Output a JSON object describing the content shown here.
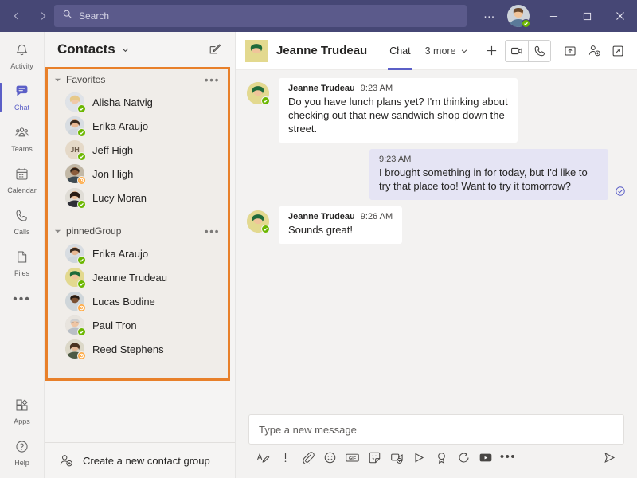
{
  "titlebar": {
    "back_icon": "chevron-left-icon",
    "forward_icon": "chevron-right-icon",
    "search_placeholder": "Search",
    "search_icon": "search-icon",
    "more_label": "…",
    "minimize_label": "—",
    "maximize_label": "□",
    "close_label": "✕",
    "accent_color": "#464775",
    "my_presence": "available"
  },
  "rail": {
    "items": [
      {
        "label": "Activity",
        "icon": "bell-icon",
        "active": false
      },
      {
        "label": "Chat",
        "icon": "chat-icon",
        "active": true
      },
      {
        "label": "Teams",
        "icon": "teams-icon",
        "active": false
      },
      {
        "label": "Calendar",
        "icon": "calendar-icon",
        "active": false
      },
      {
        "label": "Calls",
        "icon": "phone-icon",
        "active": false
      },
      {
        "label": "Files",
        "icon": "file-icon",
        "active": false
      }
    ],
    "more_label": "•••",
    "bottom_items": [
      {
        "label": "Apps",
        "icon": "apps-icon"
      },
      {
        "label": "Help",
        "icon": "help-icon"
      }
    ]
  },
  "contacts": {
    "title": "Contacts",
    "title_chevron_icon": "chevron-down-icon",
    "compose_icon": "new-chat-icon",
    "highlight_color": "#e8802a",
    "groups": [
      {
        "name": "Favorites",
        "collapse_icon": "caret-down-icon",
        "overflow_label": "•••",
        "people": [
          {
            "name": "Alisha Natvig",
            "presence": "available",
            "avatar_type": "photo",
            "hair": "#e6c98a",
            "skin": "#f0c9a8",
            "shirt": "#dfe3e8"
          },
          {
            "name": "Erika Araujo",
            "presence": "available",
            "avatar_type": "photo",
            "hair": "#3a2b20",
            "skin": "#e8b894",
            "shirt": "#d8dde2"
          },
          {
            "name": "Jeff High",
            "presence": "available",
            "avatar_type": "initials",
            "initials": "JH"
          },
          {
            "name": "Jon High",
            "presence": "away",
            "avatar_type": "photo",
            "hair": "#2d2016",
            "skin": "#8a5c3b",
            "shirt": "#3e4a52"
          },
          {
            "name": "Lucy Moran",
            "presence": "available",
            "avatar_type": "photo",
            "hair": "#2a1d14",
            "skin": "#eec3a0",
            "shirt": "#2f2f38"
          }
        ]
      },
      {
        "name": "pinnedGroup",
        "collapse_icon": "caret-down-icon",
        "overflow_label": "•••",
        "people": [
          {
            "name": "Erika Araujo",
            "presence": "available",
            "avatar_type": "photo",
            "hair": "#3a2b20",
            "skin": "#e8b894",
            "shirt": "#d8dde2"
          },
          {
            "name": "Jeanne Trudeau",
            "presence": "available",
            "avatar_type": "photo",
            "hair": "#1f6b3a",
            "skin": "#f0c49a",
            "shirt": "#e3d98f"
          },
          {
            "name": "Lucas Bodine",
            "presence": "away",
            "avatar_type": "photo",
            "hair": "#241a12",
            "skin": "#7a5032",
            "shirt": "#cfd6da"
          },
          {
            "name": "Paul Tron",
            "presence": "available",
            "avatar_type": "photo",
            "hair": "#cfcfcf",
            "skin": "#eec5a4",
            "shirt": "#e8e4de"
          },
          {
            "name": "Reed Stephens",
            "presence": "away",
            "avatar_type": "photo",
            "hair": "#4a3320",
            "skin": "#e3b896",
            "shirt": "#4d5b45"
          }
        ]
      }
    ],
    "create_group_label": "Create a new contact group",
    "create_group_icon": "add-person-icon"
  },
  "chat_header": {
    "name": "Jeanne Trudeau",
    "tabs": [
      {
        "label": "Chat",
        "active": true
      },
      {
        "label": "3 more",
        "active": false,
        "chevron_icon": "chevron-down-icon"
      }
    ],
    "add_tab_label": "+",
    "actions": [
      {
        "name": "video-call-icon"
      },
      {
        "name": "audio-call-icon"
      },
      {
        "name": "share-screen-icon"
      },
      {
        "name": "add-people-icon"
      },
      {
        "name": "popout-icon"
      }
    ]
  },
  "messages": [
    {
      "direction": "in",
      "author": "Jeanne Trudeau",
      "time": "9:23 AM",
      "text": "Do you have lunch plans yet? I'm thinking about checking out that new sandwich shop down the street.",
      "show_avatar": true,
      "presence": "available"
    },
    {
      "direction": "out",
      "author": "",
      "time": "9:23 AM",
      "text": "I brought something in for today, but I'd like to try that place too! Want to try it tomorrow?",
      "show_avatar": false,
      "status_icon": "seen-check-icon"
    },
    {
      "direction": "in",
      "author": "Jeanne Trudeau",
      "time": "9:26 AM",
      "text": "Sounds great!",
      "show_avatar": true,
      "presence": "available"
    }
  ],
  "compose": {
    "placeholder": "Type a new message",
    "value": "",
    "toolbar": [
      {
        "name": "format-icon"
      },
      {
        "name": "important-icon"
      },
      {
        "name": "attach-icon"
      },
      {
        "name": "emoji-icon"
      },
      {
        "name": "gif-icon"
      },
      {
        "name": "sticker-icon"
      },
      {
        "name": "meeting-icon"
      },
      {
        "name": "stream-icon"
      },
      {
        "name": "praise-icon"
      },
      {
        "name": "approvals-icon"
      },
      {
        "name": "video-clip-icon"
      },
      {
        "name": "more-options-icon",
        "label": "•••"
      }
    ],
    "send_icon": "send-icon"
  }
}
